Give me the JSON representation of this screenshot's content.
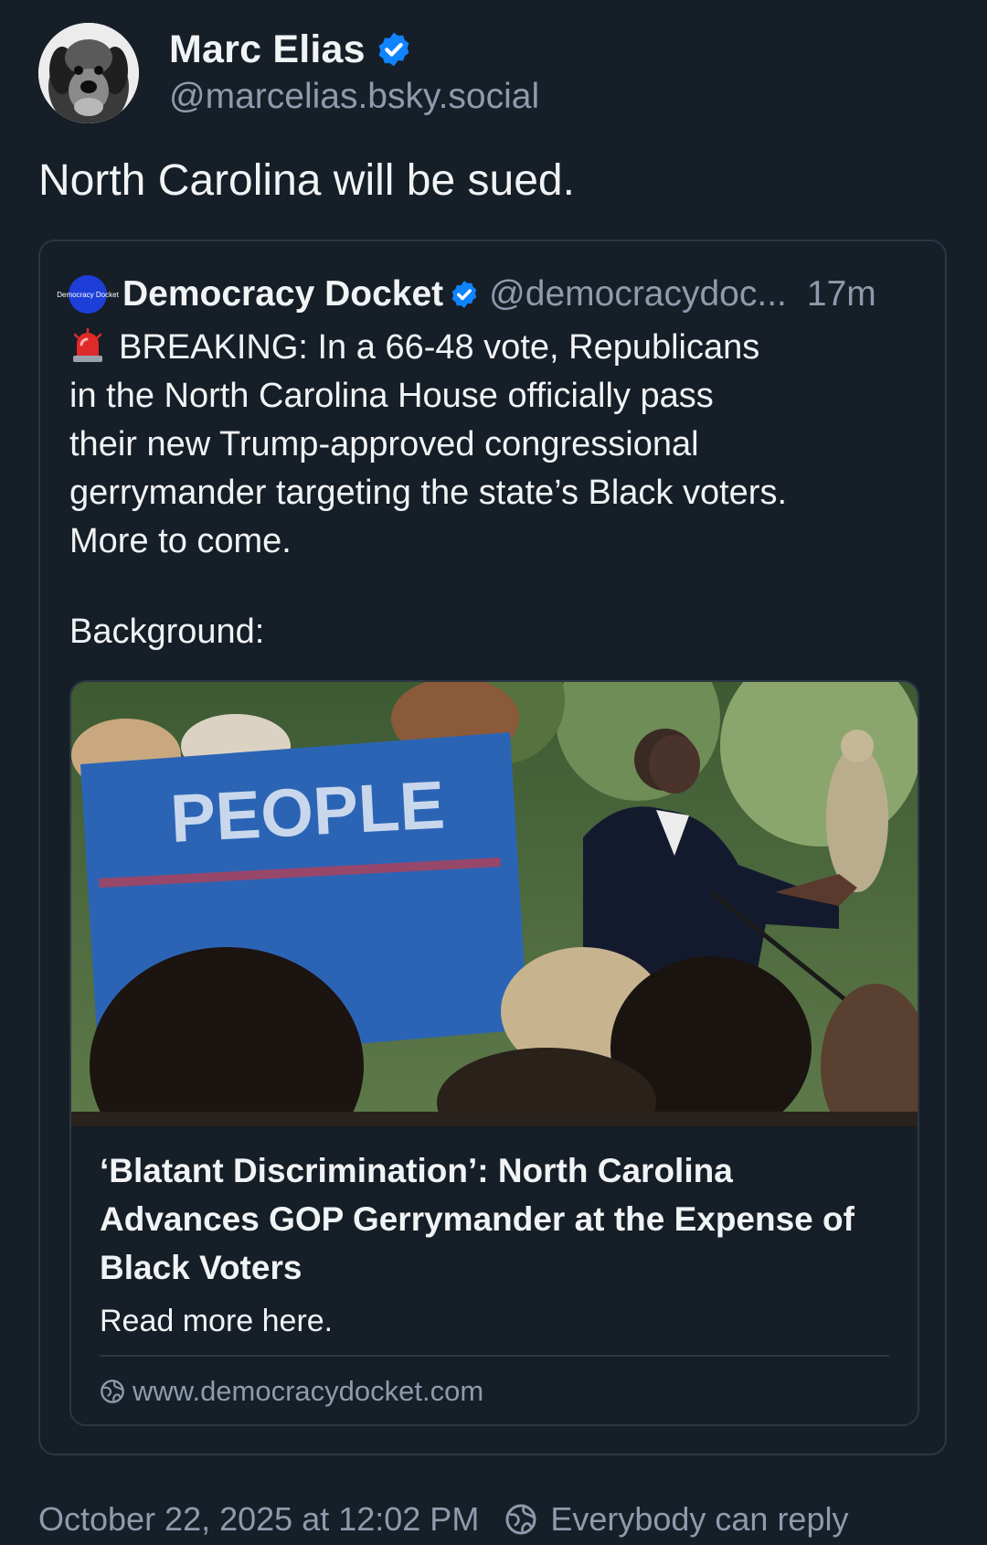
{
  "post": {
    "author": {
      "display_name": "Marc Elias",
      "handle": "@marcelias.bsky.social",
      "verified": true
    },
    "text": "North Carolina will be sued.",
    "quoted_post": {
      "author": {
        "avatar_text": "Democracy Docket",
        "display_name": "Democracy Docket",
        "handle": "@democracydoc...",
        "verified": true
      },
      "time_ago": "17m",
      "body_lines": [
        "BREAKING: In a 66-48 vote, Republicans",
        "in the North Carolina House officially pass",
        "their new Trump-approved congressional",
        "gerrymander targeting the state’s Black voters.",
        "More to come."
      ],
      "background_label": "Background:",
      "link_card": {
        "image_sign_text": "PEOPLE",
        "title": "‘Blatant Discrimination’: North Carolina Advances GOP Gerrymander at the Expense of Black Voters",
        "description": "Read more here.",
        "domain": "www.democracydocket.com"
      }
    },
    "timestamp": "October 22, 2025 at 12:02 PM",
    "reply_setting": "Everybody can reply"
  },
  "colors": {
    "background": "#161e27",
    "text": "#f1f3f5",
    "muted_text": "#8d9bac",
    "border": "#2c3744",
    "verified_blue": "#1083fe"
  },
  "icons": {
    "verified": "verified-badge-icon",
    "siren": "police-siren-emoji-icon",
    "globe": "globe-icon",
    "reply": "everybody-can-reply-icon"
  }
}
